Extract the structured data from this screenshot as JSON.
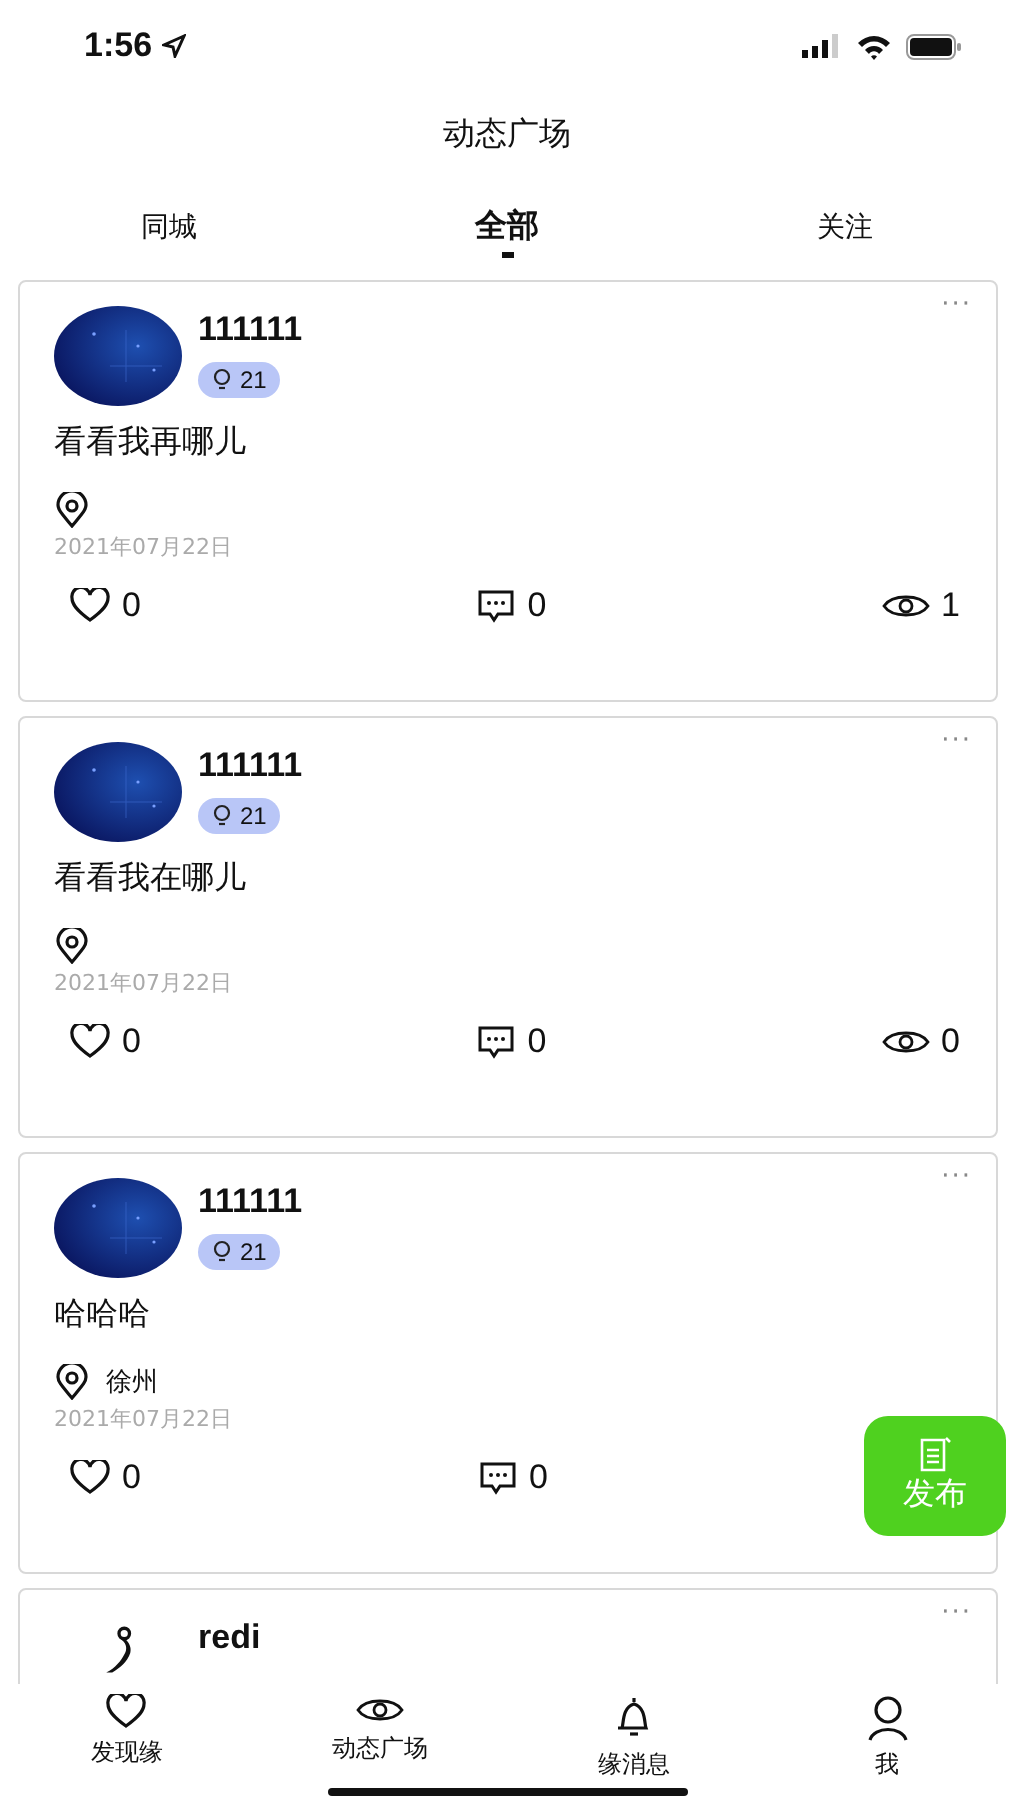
{
  "status_bar": {
    "time": "1:56"
  },
  "header": {
    "title": "动态广场"
  },
  "tabs": [
    {
      "label": "同城",
      "selected": false
    },
    {
      "label": "全部",
      "selected": true
    },
    {
      "label": "关注",
      "selected": false
    }
  ],
  "posts": [
    {
      "name": "111111",
      "more": "···",
      "badge": "21",
      "content": "看看我再哪儿",
      "date": "2021年07月22日",
      "likes": "0",
      "comments": "0",
      "views": "1"
    },
    {
      "name": "111111",
      "more": "···",
      "badge": "21",
      "content": "看看我在哪儿",
      "date": "2021年07月22日",
      "likes": "0",
      "comments": "0",
      "views": "0"
    },
    {
      "name": "111111",
      "more": "···",
      "badge": "21",
      "content": "哈哈哈",
      "location": "徐州",
      "date": "2021年07月22日",
      "likes": "0",
      "comments": "0"
    },
    {
      "avatar": {
        "kind": "figure"
      },
      "name": "redi",
      "more": "···"
    }
  ],
  "fab": {
    "label": "发布"
  },
  "bottom_nav": [
    {
      "label": "发现缘"
    },
    {
      "label": "动态广场"
    },
    {
      "label": "缘消息"
    },
    {
      "label": "我"
    }
  ]
}
